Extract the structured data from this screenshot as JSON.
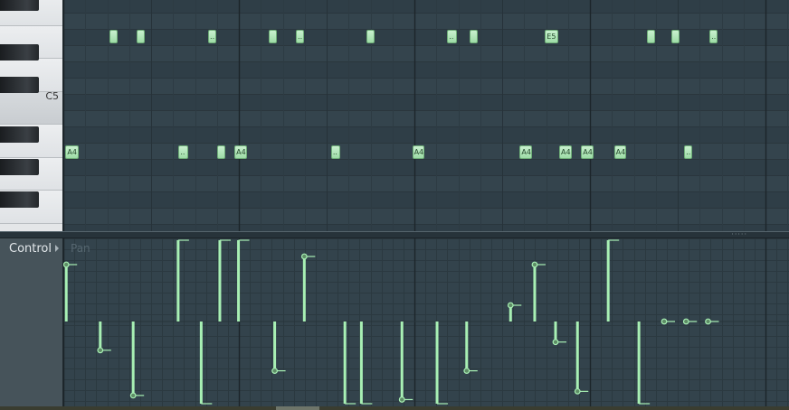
{
  "piano": {
    "key_label": "C5",
    "black_keys": [
      1,
      3,
      5,
      7,
      9,
      11
    ],
    "white_keys": 7
  },
  "notes": [
    {
      "step": 0.1,
      "len": 1.0,
      "label": "A4",
      "pitch": "A4"
    },
    {
      "step": 2.1,
      "len": 0.6,
      "label": "",
      "pitch": "E5"
    },
    {
      "step": 3.35,
      "len": 0.6,
      "label": "",
      "pitch": "E5"
    },
    {
      "step": 5.25,
      "len": 0.7,
      "label": "..",
      "pitch": "A4"
    },
    {
      "step": 6.6,
      "len": 0.6,
      "label": "..",
      "pitch": "E5"
    },
    {
      "step": 7.0,
      "len": 0.6,
      "label": "",
      "pitch": "A4"
    },
    {
      "step": 7.8,
      "len": 0.9,
      "label": "A4",
      "pitch": "A4"
    },
    {
      "step": 9.35,
      "len": 0.5,
      "label": "",
      "pitch": "E5"
    },
    {
      "step": 10.6,
      "len": 0.6,
      "label": "..",
      "pitch": "E5"
    },
    {
      "step": 12.2,
      "len": 0.7,
      "label": "..",
      "pitch": "A4"
    },
    {
      "step": 13.8,
      "len": 0.6,
      "label": "",
      "pitch": "E5"
    },
    {
      "step": 15.9,
      "len": 0.9,
      "label": "A4",
      "pitch": "A4"
    },
    {
      "step": 17.5,
      "len": 0.7,
      "label": "..",
      "pitch": "E5"
    },
    {
      "step": 18.5,
      "len": 0.6,
      "label": "",
      "pitch": "E5"
    },
    {
      "step": 20.8,
      "len": 0.9,
      "label": "A4",
      "pitch": "A4"
    },
    {
      "step": 21.95,
      "len": 1.0,
      "label": "E5",
      "pitch": "E5"
    },
    {
      "step": 22.6,
      "len": 0.9,
      "label": "A4",
      "pitch": "A4"
    },
    {
      "step": 23.6,
      "len": 0.9,
      "label": "A4",
      "pitch": "A4"
    },
    {
      "step": 25.1,
      "len": 0.9,
      "label": "A4",
      "pitch": "A4"
    },
    {
      "step": 26.6,
      "len": 0.6,
      "label": "",
      "pitch": "E5"
    },
    {
      "step": 27.7,
      "len": 0.6,
      "label": "",
      "pitch": "E5"
    },
    {
      "step": 28.3,
      "len": 0.6,
      "label": "..",
      "pitch": "A4"
    },
    {
      "step": 29.45,
      "len": 0.6,
      "label": "..",
      "pitch": "E5"
    }
  ],
  "control": {
    "label": "Control",
    "parameter": "Pan"
  },
  "pan_events": [
    {
      "step": 0.05,
      "value": 0.7
    },
    {
      "step": 1.6,
      "value": -0.35
    },
    {
      "step": 3.1,
      "value": -0.9
    },
    {
      "step": 5.15,
      "value": 1.0
    },
    {
      "step": 6.2,
      "value": -1.0
    },
    {
      "step": 7.05,
      "value": 1.0
    },
    {
      "step": 7.9,
      "value": 1.0
    },
    {
      "step": 9.55,
      "value": -0.6
    },
    {
      "step": 10.9,
      "value": 0.8
    },
    {
      "step": 12.75,
      "value": -1.0
    },
    {
      "step": 13.5,
      "value": -1.0
    },
    {
      "step": 15.35,
      "value": -0.95
    },
    {
      "step": 16.95,
      "value": -1.0
    },
    {
      "step": 18.3,
      "value": -0.6
    },
    {
      "step": 20.3,
      "value": 0.2
    },
    {
      "step": 21.4,
      "value": 0.7
    },
    {
      "step": 22.35,
      "value": -0.25
    },
    {
      "step": 23.35,
      "value": -0.85
    },
    {
      "step": 24.75,
      "value": 1.0
    },
    {
      "step": 26.15,
      "value": -1.0
    },
    {
      "step": 27.3,
      "value": 0.0
    },
    {
      "step": 28.3,
      "value": 0.0
    },
    {
      "step": 29.3,
      "value": 0.0
    }
  ],
  "colors": {
    "grid_bg": "#34444d",
    "grid_bg_alt": "#2f3e47",
    "note_fill": "#b3e7bb",
    "event_color": "#a8f0b4"
  }
}
